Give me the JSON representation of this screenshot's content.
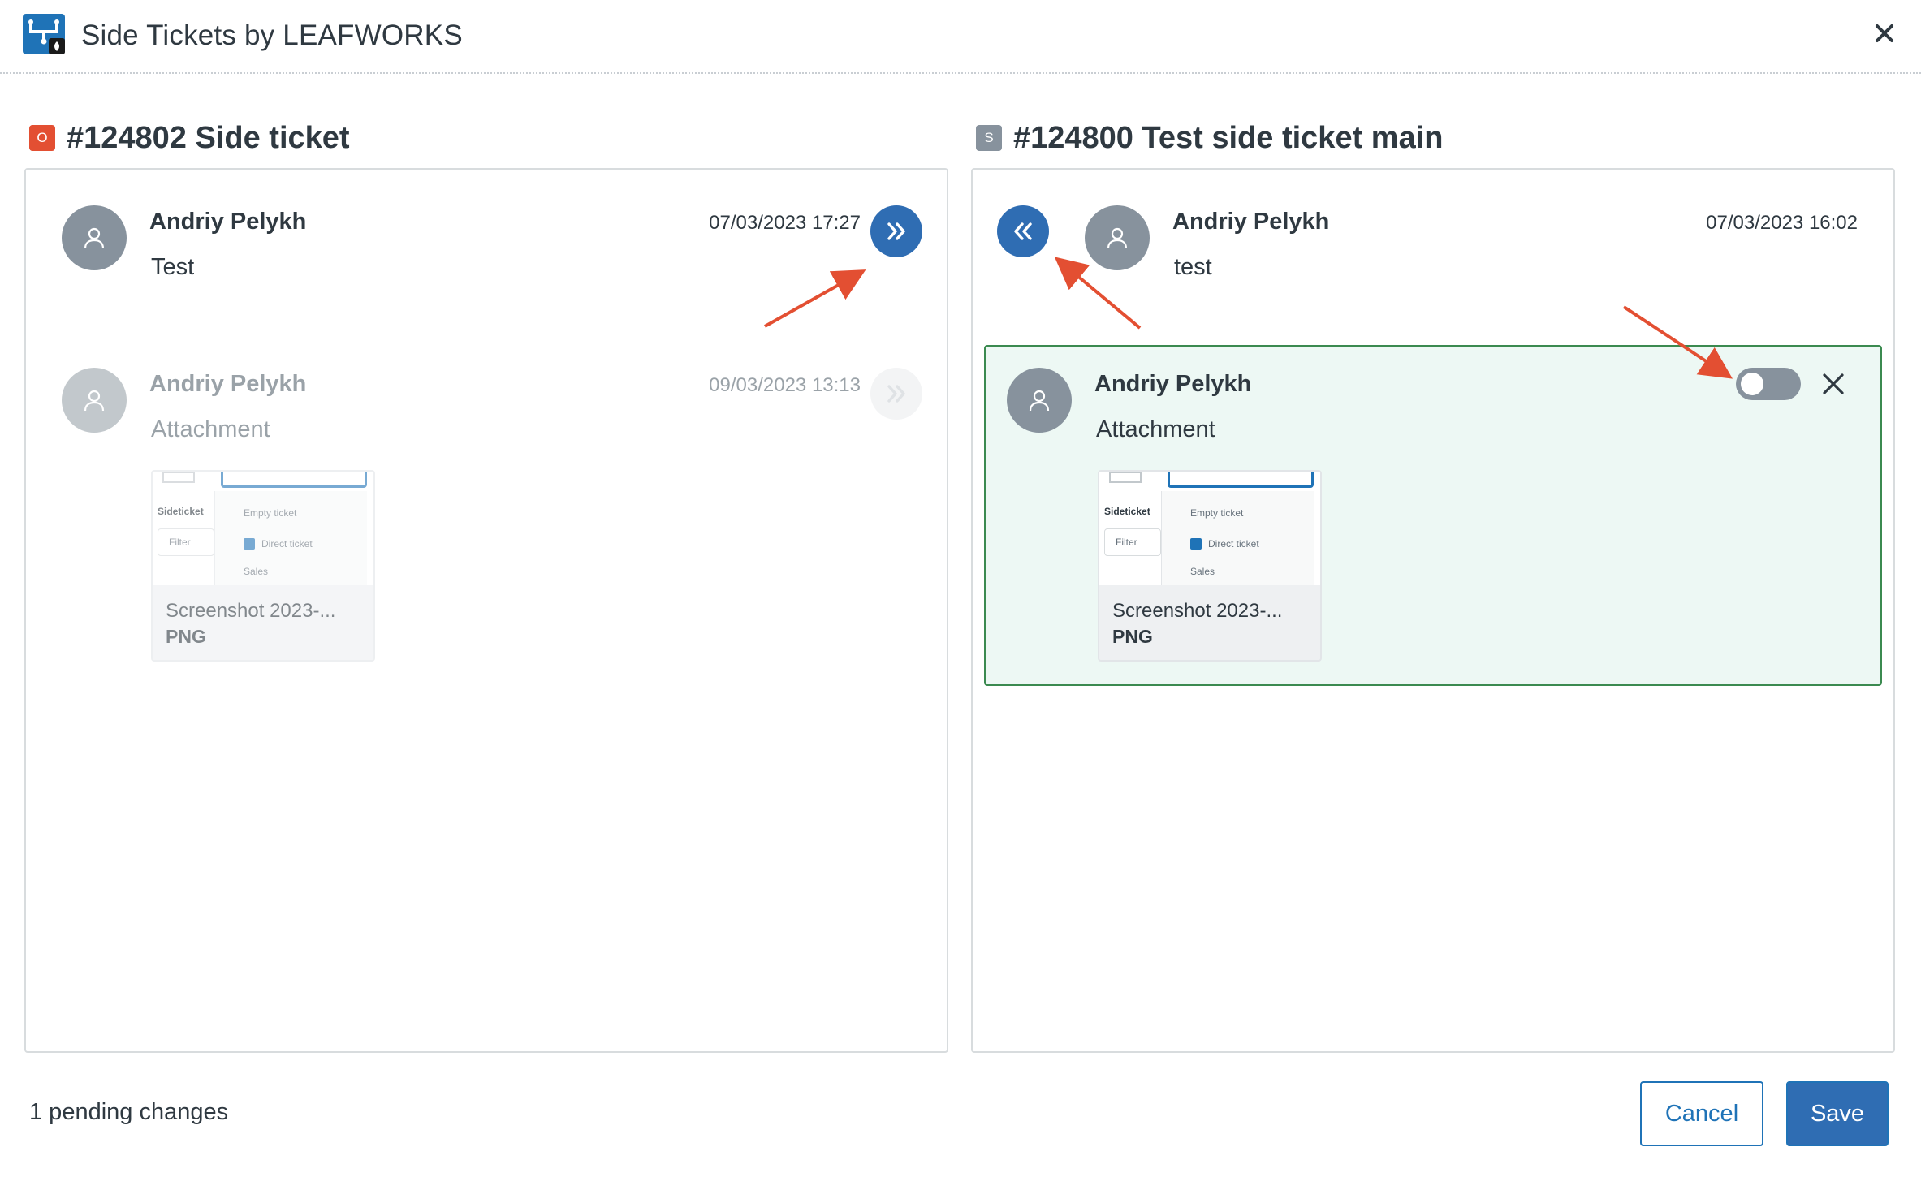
{
  "header": {
    "title": "Side Tickets by LEAFWORKS"
  },
  "colors": {
    "brand_blue": "#1f73b7",
    "status_open": "#e34f32",
    "status_solved": "#87929d",
    "selected_bg": "#edf8f4",
    "selected_border": "#3b8a50",
    "annotation_red": "#e34f32"
  },
  "left_ticket": {
    "badge": "O",
    "title": "#124802 Side ticket",
    "comments": [
      {
        "author": "Andriy Pelykh",
        "timestamp": "07/03/2023 17:27",
        "body": "Test",
        "action_icon": "chevrons-right-icon"
      },
      {
        "author": "Andriy Pelykh",
        "timestamp": "09/03/2023 13:13",
        "body": "Attachment",
        "action_icon": "chevrons-right-icon",
        "attachment": {
          "name": "Screenshot 2023-...",
          "type": "PNG"
        }
      }
    ]
  },
  "right_ticket": {
    "badge": "S",
    "title": "#124800 Test side ticket main",
    "comments": [
      {
        "author": "Andriy Pelykh",
        "timestamp": "07/03/2023 16:02",
        "body": "test",
        "action_icon": "chevrons-left-icon"
      },
      {
        "author": "Andriy Pelykh",
        "body": "Attachment",
        "toggle_on": false,
        "attachment": {
          "name": "Screenshot 2023-...",
          "type": "PNG"
        }
      }
    ]
  },
  "thumbnail": {
    "group_label": "Sideticket",
    "search_placeholder": "Filter",
    "items": [
      "Empty ticket",
      "Direct ticket",
      "Sales"
    ]
  },
  "footer": {
    "pending": "1 pending changes",
    "cancel_label": "Cancel",
    "save_label": "Save"
  }
}
